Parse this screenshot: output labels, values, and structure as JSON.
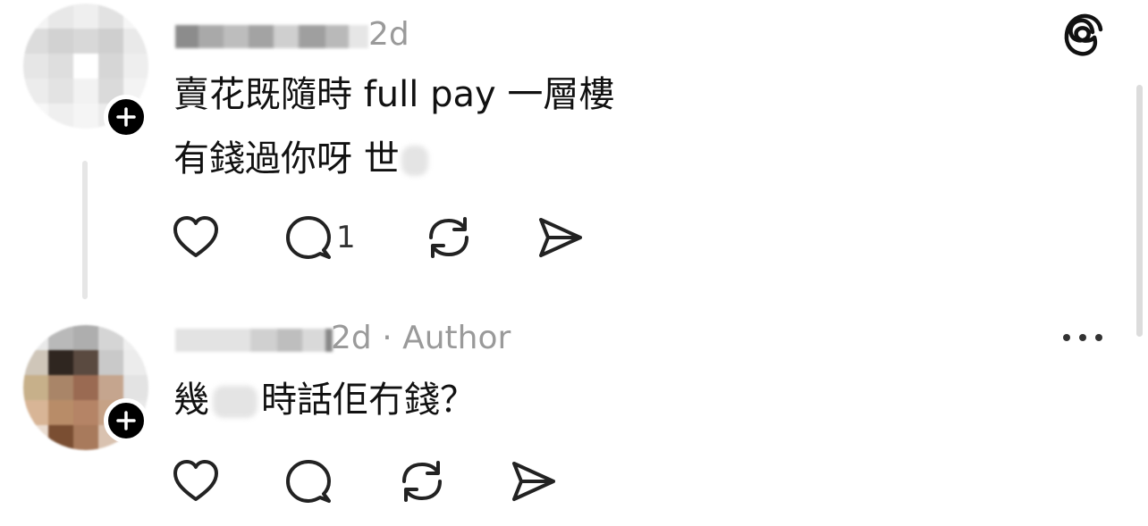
{
  "comments": [
    {
      "time": "2d",
      "body_lines": [
        "賣花既隨時 full pay 一層樓",
        "有錢過你呀 世"
      ],
      "reply_count": "1"
    },
    {
      "time": "2d",
      "author_badge": "· Author",
      "body_prefix": "幾",
      "body_suffix": "時話佢冇錢？"
    }
  ],
  "icons": {
    "app": "threads-logo-icon",
    "like": "heart-icon",
    "reply": "comment-bubble-icon",
    "repost": "repost-icon",
    "share": "send-icon",
    "more": "more-options-icon",
    "follow": "plus-icon"
  }
}
